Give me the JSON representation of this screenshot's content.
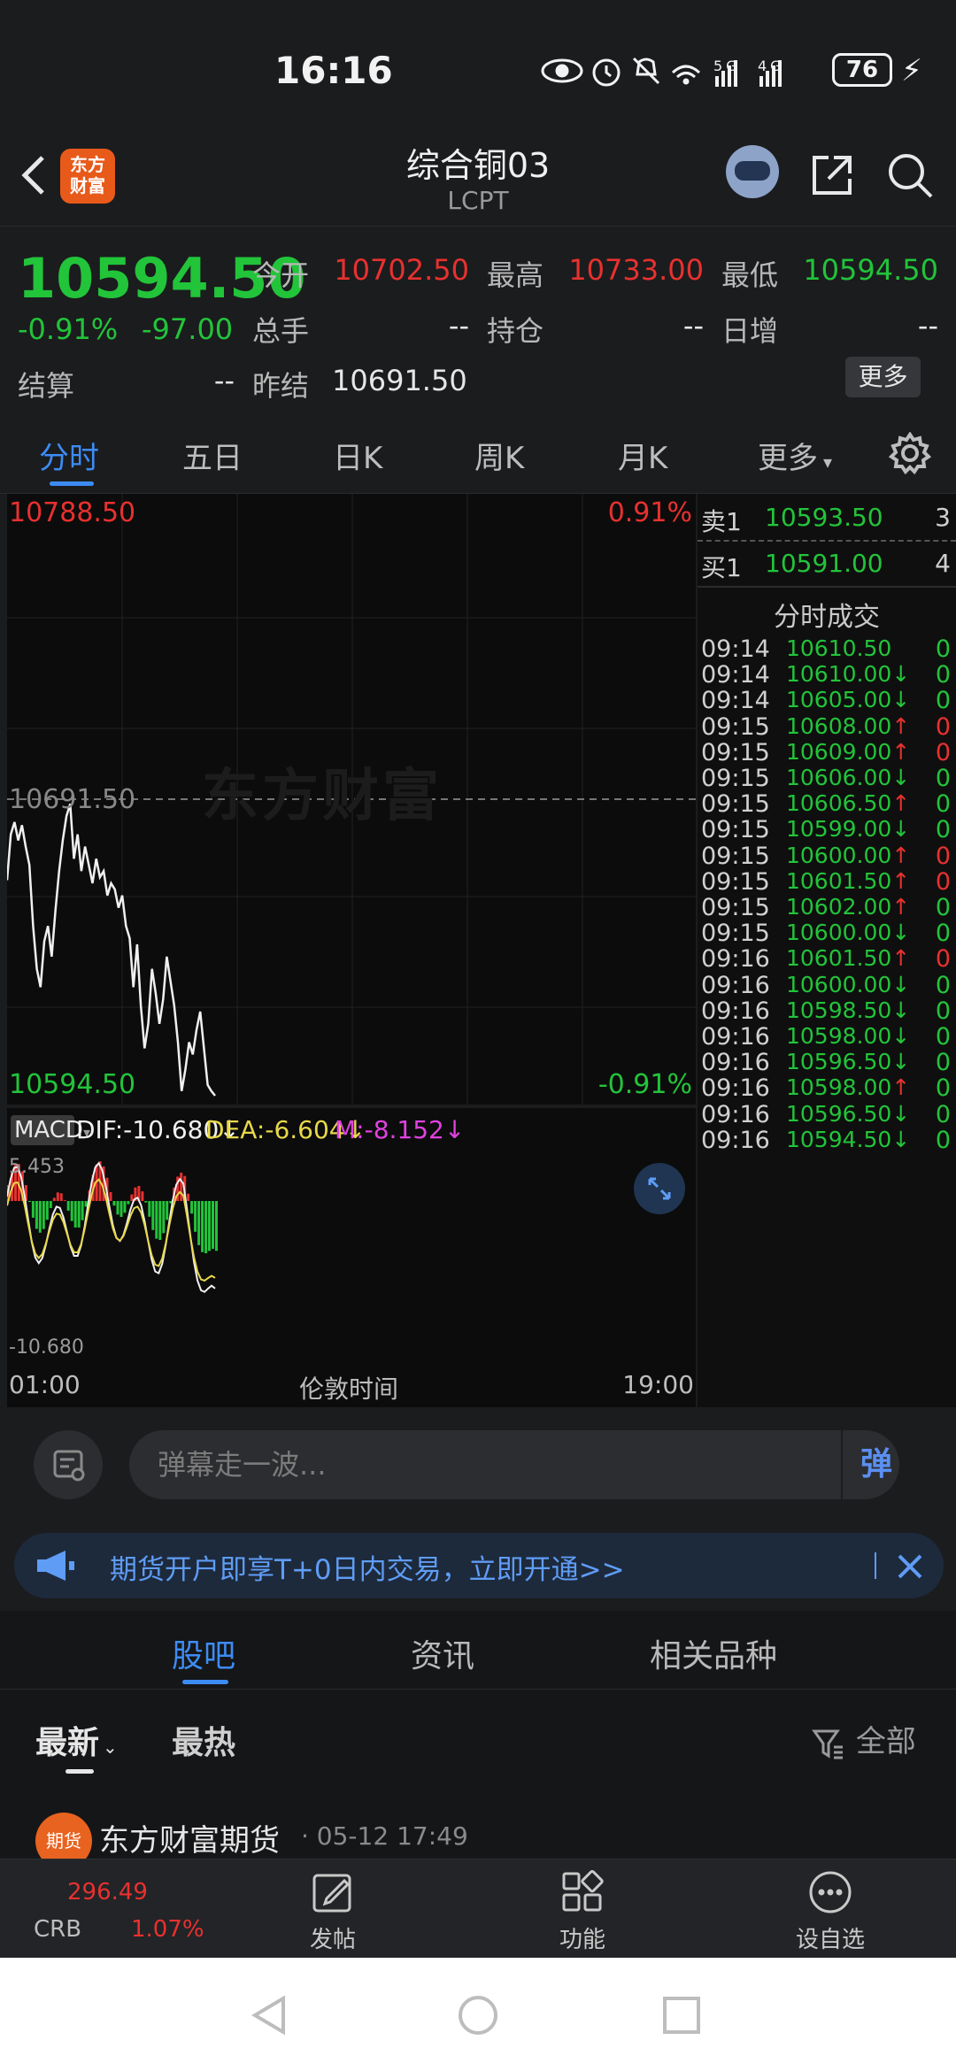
{
  "status": {
    "time": "16:16",
    "battery": "76",
    "network": "5G 4G"
  },
  "header": {
    "title": "综合铜03",
    "subtitle": "LCPT",
    "logo_text": "东方\n财富"
  },
  "quote": {
    "price": "10594.50",
    "change_pct": "-0.91%",
    "change_val": "-97.00",
    "open_label": "今开",
    "open": "10702.50",
    "high_label": "最高",
    "high": "10733.00",
    "low_label": "最低",
    "low": "10594.50",
    "volume_label": "总手",
    "volume": "--",
    "position_label": "持仓",
    "position": "--",
    "daily_inc_label": "日增",
    "daily_inc": "--",
    "settle_label": "结算",
    "settle": "--",
    "prev_settle_label": "昨结",
    "prev_settle": "10691.50",
    "more_label": "更多"
  },
  "tabs": [
    "分时",
    "五日",
    "日K",
    "周K",
    "月K",
    "更多"
  ],
  "chart": {
    "high_price": "10788.50",
    "high_pct": "0.91%",
    "mid_price": "10691.50",
    "low_price": "10594.50",
    "low_pct": "-0.91%",
    "watermark": "东方财富",
    "macd_label": "MACD",
    "dif": "DIF:-10.680↓",
    "dea": "DEA:-6.604↓",
    "m": "M:-8.152↓",
    "macd_top": "5.453",
    "macd_bottom": "-10.680",
    "time_start": "01:00",
    "time_mid": "伦敦时间",
    "time_end": "19:00"
  },
  "chart_data": {
    "type": "line",
    "title": "",
    "y_range": [
      10594.5,
      10788.5
    ],
    "reference": 10691.5,
    "price_values": [
      10665,
      10680,
      10684,
      10678,
      10683,
      10676,
      10670,
      10650,
      10636,
      10630,
      10645,
      10650,
      10640,
      10655,
      10668,
      10678,
      10686,
      10690,
      10672,
      10680,
      10668,
      10676,
      10670,
      10664,
      10672,
      10666,
      10668,
      10660,
      10664,
      10662,
      10656,
      10660,
      10650,
      10646,
      10630,
      10644,
      10624,
      10610,
      10618,
      10636,
      10628,
      10618,
      10626,
      10640,
      10632,
      10624,
      10612,
      10596,
      10603,
      10612,
      10608,
      10616,
      10622,
      10610,
      10598,
      10596,
      10594.5
    ]
  },
  "order_book": {
    "ask_label": "卖1",
    "ask_price": "10593.50",
    "ask_vol": "3",
    "bid_label": "买1",
    "bid_price": "10591.00",
    "bid_vol": "4",
    "trades_title": "分时成交",
    "trades": [
      {
        "t": "09:14",
        "p": "10610.50",
        "a": "",
        "v": "0",
        "c": "green"
      },
      {
        "t": "09:14",
        "p": "10610.00",
        "a": "↓",
        "v": "0",
        "c": "green"
      },
      {
        "t": "09:14",
        "p": "10605.00",
        "a": "↓",
        "v": "0",
        "c": "green"
      },
      {
        "t": "09:15",
        "p": "10608.00",
        "a": "↑",
        "v": "0",
        "c": "red"
      },
      {
        "t": "09:15",
        "p": "10609.00",
        "a": "↑",
        "v": "0",
        "c": "red"
      },
      {
        "t": "09:15",
        "p": "10606.00",
        "a": "↓",
        "v": "0",
        "c": "green"
      },
      {
        "t": "09:15",
        "p": "10606.50",
        "a": "↑",
        "v": "0",
        "c": "green"
      },
      {
        "t": "09:15",
        "p": "10599.00",
        "a": "↓",
        "v": "0",
        "c": "green"
      },
      {
        "t": "09:15",
        "p": "10600.00",
        "a": "↑",
        "v": "0",
        "c": "red"
      },
      {
        "t": "09:15",
        "p": "10601.50",
        "a": "↑",
        "v": "0",
        "c": "red"
      },
      {
        "t": "09:15",
        "p": "10602.00",
        "a": "↑",
        "v": "0",
        "c": "green"
      },
      {
        "t": "09:15",
        "p": "10600.00",
        "a": "↓",
        "v": "0",
        "c": "green"
      },
      {
        "t": "09:16",
        "p": "10601.50",
        "a": "↑",
        "v": "0",
        "c": "red"
      },
      {
        "t": "09:16",
        "p": "10600.00",
        "a": "↓",
        "v": "0",
        "c": "green"
      },
      {
        "t": "09:16",
        "p": "10598.50",
        "a": "↓",
        "v": "0",
        "c": "green"
      },
      {
        "t": "09:16",
        "p": "10598.00",
        "a": "↓",
        "v": "0",
        "c": "green"
      },
      {
        "t": "09:16",
        "p": "10596.50",
        "a": "↓",
        "v": "0",
        "c": "green"
      },
      {
        "t": "09:16",
        "p": "10598.00",
        "a": "↑",
        "v": "0",
        "c": "green"
      },
      {
        "t": "09:16",
        "p": "10596.50",
        "a": "↓",
        "v": "0",
        "c": "green"
      },
      {
        "t": "09:16",
        "p": "10594.50",
        "a": "↓",
        "v": "0",
        "c": "green"
      }
    ]
  },
  "comment": {
    "placeholder": "弹幕走一波...",
    "danmu_label": "弹"
  },
  "banner": {
    "text": "期货开户即享T+0日内交易，立即开通>>"
  },
  "forum": {
    "tabs": [
      "股吧",
      "资讯",
      "相关品种"
    ],
    "sort_new": "最新",
    "sort_hot": "最热",
    "filter": "全部",
    "post_author": "东方财富期货",
    "post_time": "· 05-12 17:49",
    "post_avatar": "期货"
  },
  "bottom_nav": {
    "crb_value": "296.49",
    "crb_name": "CRB",
    "crb_pct": "1.07%",
    "post": "发帖",
    "functions": "功能",
    "watchlist": "设自选"
  },
  "colors": {
    "up": "#e8312f",
    "down": "#22c43a",
    "accent": "#3d8cf5"
  }
}
